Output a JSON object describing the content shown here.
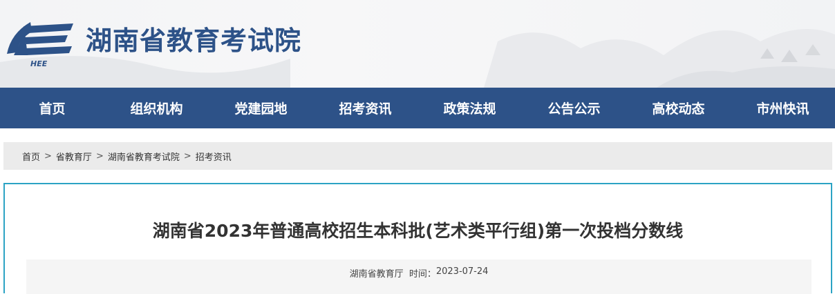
{
  "header": {
    "site_title": "湖南省教育考试院",
    "logo_text": "HEE"
  },
  "nav": {
    "items": [
      "首页",
      "组织机构",
      "党建园地",
      "招考资讯",
      "政策法规",
      "公告公示",
      "高校动态",
      "市州快讯"
    ]
  },
  "breadcrumb": {
    "items": [
      "首页",
      "省教育厅",
      "湖南省教育考试院",
      "招考资讯"
    ],
    "separator": ">"
  },
  "article": {
    "title": "湖南省2023年普通高校招生本科批(艺术类平行组)第一次投档分数线",
    "source": "湖南省教育厅",
    "time_label": "时间：",
    "time": "2023-07-24"
  },
  "colors": {
    "brand": "#2d5288",
    "frame": "#2ba3c4"
  }
}
